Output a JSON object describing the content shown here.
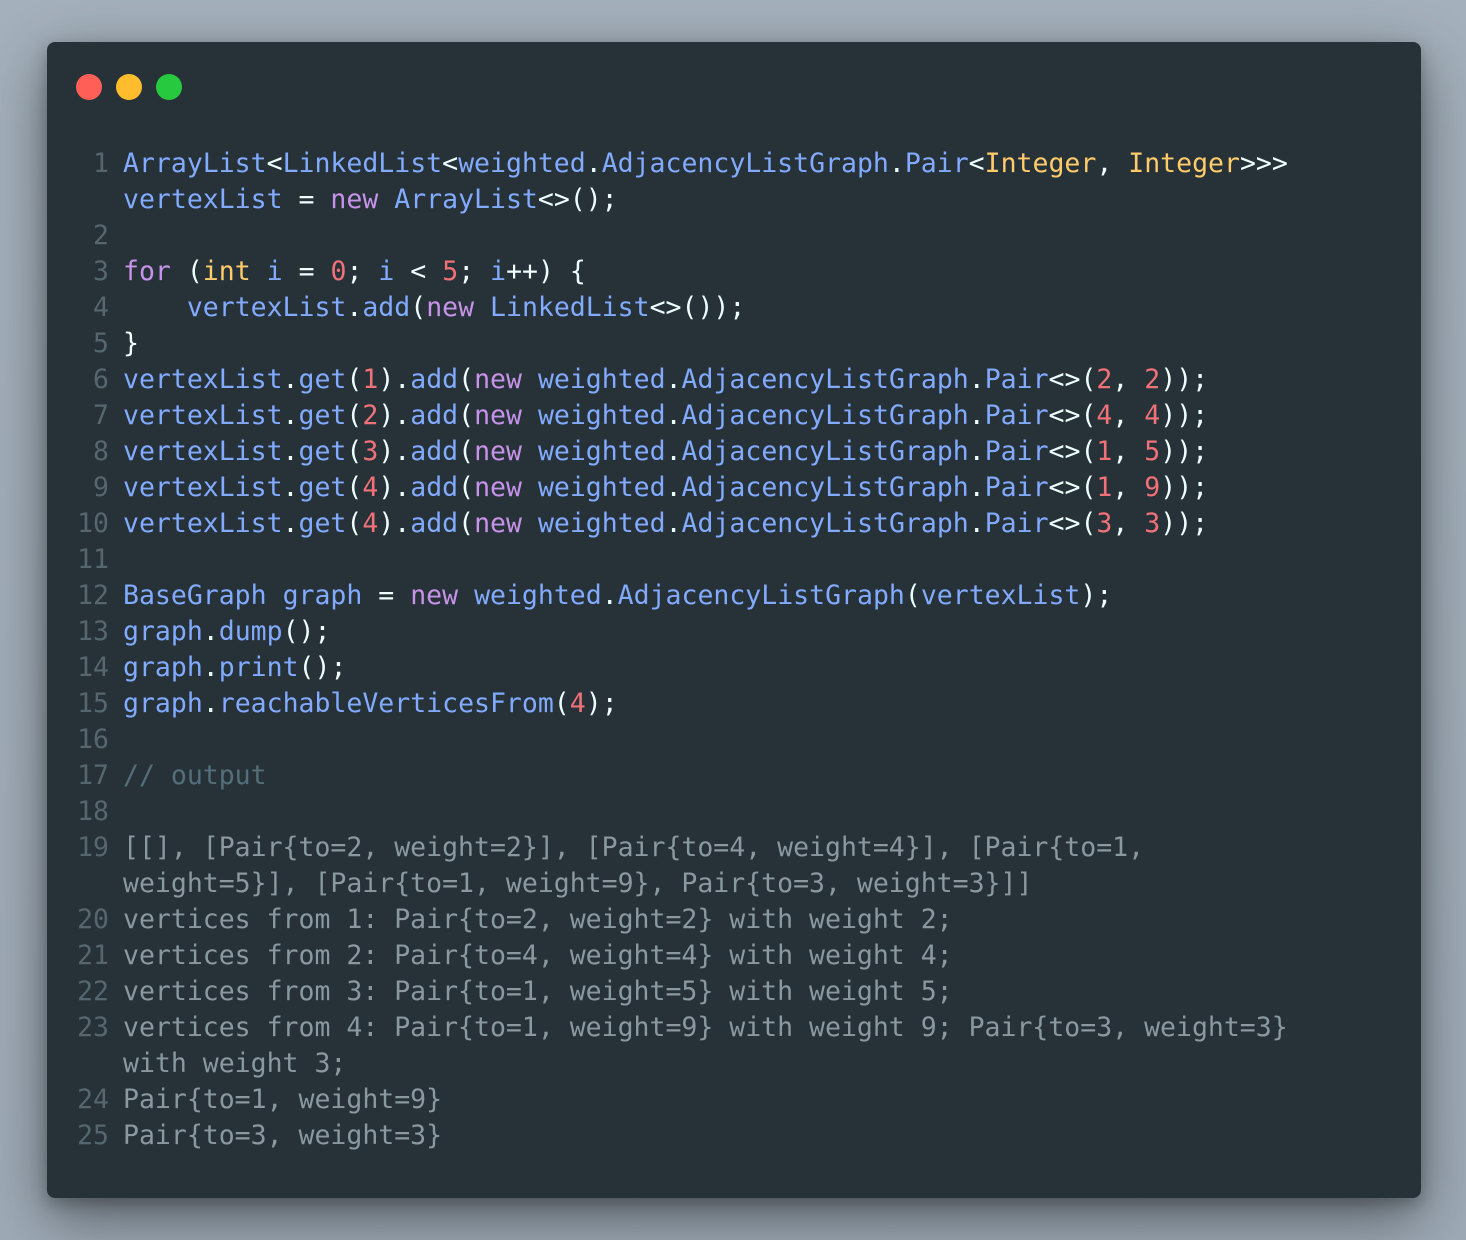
{
  "window": {
    "controls": [
      {
        "name": "close",
        "color": "#ff5f56"
      },
      {
        "name": "minimize",
        "color": "#ffbd2e"
      },
      {
        "name": "maximize",
        "color": "#27c93f"
      }
    ]
  },
  "editor": {
    "lines": [
      {
        "num": "1",
        "tokens": [
          [
            "ArrayList",
            "type"
          ],
          [
            "<",
            "punc"
          ],
          [
            "LinkedList",
            "type"
          ],
          [
            "<",
            "punc"
          ],
          [
            "weighted",
            "type"
          ],
          [
            ".",
            "punc"
          ],
          [
            "AdjacencyListGraph",
            "type"
          ],
          [
            ".",
            "punc"
          ],
          [
            "Pair",
            "type"
          ],
          [
            "<",
            "punc"
          ],
          [
            "Integer",
            "prim"
          ],
          [
            ", ",
            "punc"
          ],
          [
            "Integer",
            "prim"
          ],
          [
            ">>>",
            "punc"
          ]
        ]
      },
      {
        "num": "",
        "tokens": [
          [
            "vertexList",
            "var"
          ],
          [
            " = ",
            "punc"
          ],
          [
            "new",
            "kw"
          ],
          [
            " ",
            "punc"
          ],
          [
            "ArrayList",
            "type"
          ],
          [
            "<>();",
            "punc"
          ]
        ]
      },
      {
        "num": "2",
        "tokens": []
      },
      {
        "num": "3",
        "tokens": [
          [
            "for",
            "kw"
          ],
          [
            " (",
            "punc"
          ],
          [
            "int",
            "prim"
          ],
          [
            " ",
            "punc"
          ],
          [
            "i",
            "var"
          ],
          [
            " = ",
            "punc"
          ],
          [
            "0",
            "num"
          ],
          [
            "; ",
            "punc"
          ],
          [
            "i",
            "var"
          ],
          [
            " < ",
            "punc"
          ],
          [
            "5",
            "num"
          ],
          [
            "; ",
            "punc"
          ],
          [
            "i",
            "var"
          ],
          [
            "++) {",
            "punc"
          ]
        ]
      },
      {
        "num": "4",
        "tokens": [
          [
            "    ",
            "punc"
          ],
          [
            "vertexList",
            "var"
          ],
          [
            ".",
            "punc"
          ],
          [
            "add",
            "type"
          ],
          [
            "(",
            "punc"
          ],
          [
            "new",
            "kw"
          ],
          [
            " ",
            "punc"
          ],
          [
            "LinkedList",
            "type"
          ],
          [
            "<>());",
            "punc"
          ]
        ]
      },
      {
        "num": "5",
        "tokens": [
          [
            "}",
            "punc"
          ]
        ]
      },
      {
        "num": "6",
        "tokens": [
          [
            "vertexList",
            "var"
          ],
          [
            ".",
            "punc"
          ],
          [
            "get",
            "type"
          ],
          [
            "(",
            "punc"
          ],
          [
            "1",
            "num"
          ],
          [
            ").",
            "punc"
          ],
          [
            "add",
            "type"
          ],
          [
            "(",
            "punc"
          ],
          [
            "new",
            "kw"
          ],
          [
            " ",
            "punc"
          ],
          [
            "weighted",
            "type"
          ],
          [
            ".",
            "punc"
          ],
          [
            "AdjacencyListGraph",
            "type"
          ],
          [
            ".",
            "punc"
          ],
          [
            "Pair",
            "type"
          ],
          [
            "<>(",
            "punc"
          ],
          [
            "2",
            "num"
          ],
          [
            ", ",
            "punc"
          ],
          [
            "2",
            "num"
          ],
          [
            "));",
            "punc"
          ]
        ]
      },
      {
        "num": "7",
        "tokens": [
          [
            "vertexList",
            "var"
          ],
          [
            ".",
            "punc"
          ],
          [
            "get",
            "type"
          ],
          [
            "(",
            "punc"
          ],
          [
            "2",
            "num"
          ],
          [
            ").",
            "punc"
          ],
          [
            "add",
            "type"
          ],
          [
            "(",
            "punc"
          ],
          [
            "new",
            "kw"
          ],
          [
            " ",
            "punc"
          ],
          [
            "weighted",
            "type"
          ],
          [
            ".",
            "punc"
          ],
          [
            "AdjacencyListGraph",
            "type"
          ],
          [
            ".",
            "punc"
          ],
          [
            "Pair",
            "type"
          ],
          [
            "<>(",
            "punc"
          ],
          [
            "4",
            "num"
          ],
          [
            ", ",
            "punc"
          ],
          [
            "4",
            "num"
          ],
          [
            "));",
            "punc"
          ]
        ]
      },
      {
        "num": "8",
        "tokens": [
          [
            "vertexList",
            "var"
          ],
          [
            ".",
            "punc"
          ],
          [
            "get",
            "type"
          ],
          [
            "(",
            "punc"
          ],
          [
            "3",
            "num"
          ],
          [
            ").",
            "punc"
          ],
          [
            "add",
            "type"
          ],
          [
            "(",
            "punc"
          ],
          [
            "new",
            "kw"
          ],
          [
            " ",
            "punc"
          ],
          [
            "weighted",
            "type"
          ],
          [
            ".",
            "punc"
          ],
          [
            "AdjacencyListGraph",
            "type"
          ],
          [
            ".",
            "punc"
          ],
          [
            "Pair",
            "type"
          ],
          [
            "<>(",
            "punc"
          ],
          [
            "1",
            "num"
          ],
          [
            ", ",
            "punc"
          ],
          [
            "5",
            "num"
          ],
          [
            "));",
            "punc"
          ]
        ]
      },
      {
        "num": "9",
        "tokens": [
          [
            "vertexList",
            "var"
          ],
          [
            ".",
            "punc"
          ],
          [
            "get",
            "type"
          ],
          [
            "(",
            "punc"
          ],
          [
            "4",
            "num"
          ],
          [
            ").",
            "punc"
          ],
          [
            "add",
            "type"
          ],
          [
            "(",
            "punc"
          ],
          [
            "new",
            "kw"
          ],
          [
            " ",
            "punc"
          ],
          [
            "weighted",
            "type"
          ],
          [
            ".",
            "punc"
          ],
          [
            "AdjacencyListGraph",
            "type"
          ],
          [
            ".",
            "punc"
          ],
          [
            "Pair",
            "type"
          ],
          [
            "<>(",
            "punc"
          ],
          [
            "1",
            "num"
          ],
          [
            ", ",
            "punc"
          ],
          [
            "9",
            "num"
          ],
          [
            "));",
            "punc"
          ]
        ]
      },
      {
        "num": "10",
        "tokens": [
          [
            "vertexList",
            "var"
          ],
          [
            ".",
            "punc"
          ],
          [
            "get",
            "type"
          ],
          [
            "(",
            "punc"
          ],
          [
            "4",
            "num"
          ],
          [
            ").",
            "punc"
          ],
          [
            "add",
            "type"
          ],
          [
            "(",
            "punc"
          ],
          [
            "new",
            "kw"
          ],
          [
            " ",
            "punc"
          ],
          [
            "weighted",
            "type"
          ],
          [
            ".",
            "punc"
          ],
          [
            "AdjacencyListGraph",
            "type"
          ],
          [
            ".",
            "punc"
          ],
          [
            "Pair",
            "type"
          ],
          [
            "<>(",
            "punc"
          ],
          [
            "3",
            "num"
          ],
          [
            ", ",
            "punc"
          ],
          [
            "3",
            "num"
          ],
          [
            "));",
            "punc"
          ]
        ]
      },
      {
        "num": "11",
        "tokens": []
      },
      {
        "num": "12",
        "tokens": [
          [
            "BaseGraph",
            "type"
          ],
          [
            " ",
            "punc"
          ],
          [
            "graph",
            "var"
          ],
          [
            " = ",
            "punc"
          ],
          [
            "new",
            "kw"
          ],
          [
            " ",
            "punc"
          ],
          [
            "weighted",
            "type"
          ],
          [
            ".",
            "punc"
          ],
          [
            "AdjacencyListGraph",
            "type"
          ],
          [
            "(",
            "punc"
          ],
          [
            "vertexList",
            "var"
          ],
          [
            ");",
            "punc"
          ]
        ]
      },
      {
        "num": "13",
        "tokens": [
          [
            "graph",
            "var"
          ],
          [
            ".",
            "punc"
          ],
          [
            "dump",
            "type"
          ],
          [
            "();",
            "punc"
          ]
        ]
      },
      {
        "num": "14",
        "tokens": [
          [
            "graph",
            "var"
          ],
          [
            ".",
            "punc"
          ],
          [
            "print",
            "type"
          ],
          [
            "();",
            "punc"
          ]
        ]
      },
      {
        "num": "15",
        "tokens": [
          [
            "graph",
            "var"
          ],
          [
            ".",
            "punc"
          ],
          [
            "reachableVerticesFrom",
            "type"
          ],
          [
            "(",
            "punc"
          ],
          [
            "4",
            "num"
          ],
          [
            ");",
            "punc"
          ]
        ]
      },
      {
        "num": "16",
        "tokens": []
      },
      {
        "num": "17",
        "tokens": [
          [
            "// output",
            "comment"
          ]
        ]
      },
      {
        "num": "18",
        "tokens": []
      },
      {
        "num": "19",
        "tokens": [
          [
            "[[], [Pair{to=2, weight=2}], [Pair{to=4, weight=4}], [Pair{to=1,",
            "out"
          ]
        ]
      },
      {
        "num": "",
        "tokens": [
          [
            "weight=5}], [Pair{to=1, weight=9}, Pair{to=3, weight=3}]]",
            "out"
          ]
        ]
      },
      {
        "num": "20",
        "tokens": [
          [
            "vertices from 1: Pair{to=2, weight=2} with weight 2;",
            "out"
          ]
        ]
      },
      {
        "num": "21",
        "tokens": [
          [
            "vertices from 2: Pair{to=4, weight=4} with weight 4;",
            "out"
          ]
        ]
      },
      {
        "num": "22",
        "tokens": [
          [
            "vertices from 3: Pair{to=1, weight=5} with weight 5;",
            "out"
          ]
        ]
      },
      {
        "num": "23",
        "tokens": [
          [
            "vertices from 4: Pair{to=1, weight=9} with weight 9; Pair{to=3, weight=3}",
            "out"
          ]
        ]
      },
      {
        "num": "",
        "tokens": [
          [
            "with weight 3;",
            "out"
          ]
        ]
      },
      {
        "num": "24",
        "tokens": [
          [
            "Pair{to=1, weight=9}",
            "out"
          ]
        ]
      },
      {
        "num": "25",
        "tokens": [
          [
            "Pair{to=3, weight=3}",
            "out"
          ]
        ]
      }
    ]
  }
}
